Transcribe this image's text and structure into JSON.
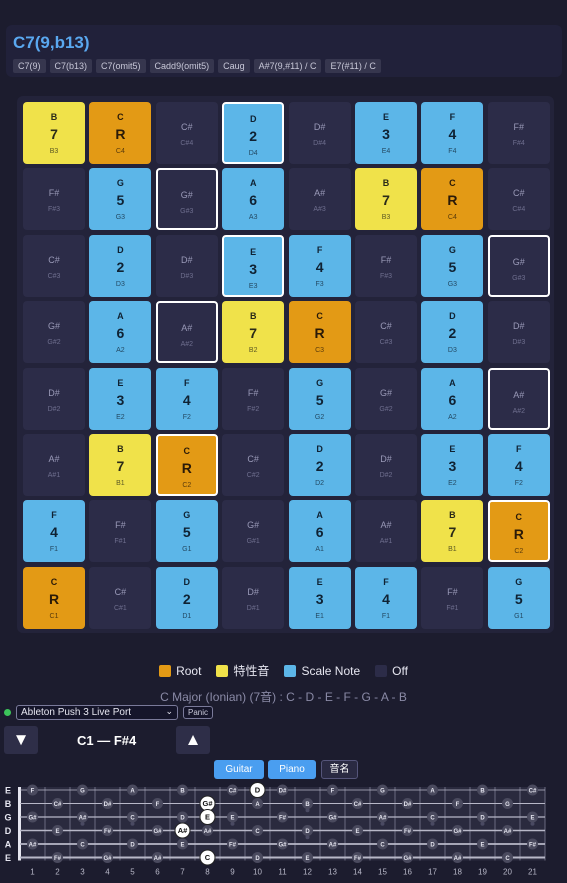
{
  "chord": {
    "title": "C7(9,b13)",
    "alternatives": [
      "C7(9)",
      "C7(b13)",
      "C7(omit5)",
      "Cadd9(omit5)",
      "Caug",
      "A#7(9,#11) / C",
      "E7(#11) / C"
    ]
  },
  "colors": {
    "root": "#e39a15",
    "characteristic": "#f0e24a",
    "scale": "#5cb6e8",
    "off": "#2c2c48"
  },
  "pads": [
    [
      {
        "n": "B",
        "d": "7",
        "s": "B3",
        "t": "char",
        "p": false
      },
      {
        "n": "C",
        "d": "R",
        "s": "C4",
        "t": "root",
        "p": false
      },
      {
        "n": "C#",
        "d": "",
        "s": "C#4",
        "t": "off",
        "p": false
      },
      {
        "n": "D",
        "d": "2",
        "s": "D4",
        "t": "scale",
        "p": true
      },
      {
        "n": "D#",
        "d": "",
        "s": "D#4",
        "t": "off",
        "p": false
      },
      {
        "n": "E",
        "d": "3",
        "s": "E4",
        "t": "scale",
        "p": false
      },
      {
        "n": "F",
        "d": "4",
        "s": "F4",
        "t": "scale",
        "p": false
      },
      {
        "n": "F#",
        "d": "",
        "s": "F#4",
        "t": "off",
        "p": false
      }
    ],
    [
      {
        "n": "F#",
        "d": "",
        "s": "F#3",
        "t": "off",
        "p": false
      },
      {
        "n": "G",
        "d": "5",
        "s": "G3",
        "t": "scale",
        "p": false
      },
      {
        "n": "G#",
        "d": "",
        "s": "G#3",
        "t": "off",
        "p": true
      },
      {
        "n": "A",
        "d": "6",
        "s": "A3",
        "t": "scale",
        "p": false
      },
      {
        "n": "A#",
        "d": "",
        "s": "A#3",
        "t": "off",
        "p": false
      },
      {
        "n": "B",
        "d": "7",
        "s": "B3",
        "t": "char",
        "p": false
      },
      {
        "n": "C",
        "d": "R",
        "s": "C4",
        "t": "root",
        "p": false
      },
      {
        "n": "C#",
        "d": "",
        "s": "C#4",
        "t": "off",
        "p": false
      }
    ],
    [
      {
        "n": "C#",
        "d": "",
        "s": "C#3",
        "t": "off",
        "p": false
      },
      {
        "n": "D",
        "d": "2",
        "s": "D3",
        "t": "scale",
        "p": false
      },
      {
        "n": "D#",
        "d": "",
        "s": "D#3",
        "t": "off",
        "p": false
      },
      {
        "n": "E",
        "d": "3",
        "s": "E3",
        "t": "scale",
        "p": true
      },
      {
        "n": "F",
        "d": "4",
        "s": "F3",
        "t": "scale",
        "p": false
      },
      {
        "n": "F#",
        "d": "",
        "s": "F#3",
        "t": "off",
        "p": false
      },
      {
        "n": "G",
        "d": "5",
        "s": "G3",
        "t": "scale",
        "p": false
      },
      {
        "n": "G#",
        "d": "",
        "s": "G#3",
        "t": "off",
        "p": true
      }
    ],
    [
      {
        "n": "G#",
        "d": "",
        "s": "G#2",
        "t": "off",
        "p": false
      },
      {
        "n": "A",
        "d": "6",
        "s": "A2",
        "t": "scale",
        "p": false
      },
      {
        "n": "A#",
        "d": "",
        "s": "A#2",
        "t": "off",
        "p": true
      },
      {
        "n": "B",
        "d": "7",
        "s": "B2",
        "t": "char",
        "p": false
      },
      {
        "n": "C",
        "d": "R",
        "s": "C3",
        "t": "root",
        "p": false
      },
      {
        "n": "C#",
        "d": "",
        "s": "C#3",
        "t": "off",
        "p": false
      },
      {
        "n": "D",
        "d": "2",
        "s": "D3",
        "t": "scale",
        "p": false
      },
      {
        "n": "D#",
        "d": "",
        "s": "D#3",
        "t": "off",
        "p": false
      }
    ],
    [
      {
        "n": "D#",
        "d": "",
        "s": "D#2",
        "t": "off",
        "p": false
      },
      {
        "n": "E",
        "d": "3",
        "s": "E2",
        "t": "scale",
        "p": false
      },
      {
        "n": "F",
        "d": "4",
        "s": "F2",
        "t": "scale",
        "p": false
      },
      {
        "n": "F#",
        "d": "",
        "s": "F#2",
        "t": "off",
        "p": false
      },
      {
        "n": "G",
        "d": "5",
        "s": "G2",
        "t": "scale",
        "p": false
      },
      {
        "n": "G#",
        "d": "",
        "s": "G#2",
        "t": "off",
        "p": false
      },
      {
        "n": "A",
        "d": "6",
        "s": "A2",
        "t": "scale",
        "p": false
      },
      {
        "n": "A#",
        "d": "",
        "s": "A#2",
        "t": "off",
        "p": true
      }
    ],
    [
      {
        "n": "A#",
        "d": "",
        "s": "A#1",
        "t": "off",
        "p": false
      },
      {
        "n": "B",
        "d": "7",
        "s": "B1",
        "t": "char",
        "p": false
      },
      {
        "n": "C",
        "d": "R",
        "s": "C2",
        "t": "root",
        "p": true
      },
      {
        "n": "C#",
        "d": "",
        "s": "C#2",
        "t": "off",
        "p": false
      },
      {
        "n": "D",
        "d": "2",
        "s": "D2",
        "t": "scale",
        "p": false
      },
      {
        "n": "D#",
        "d": "",
        "s": "D#2",
        "t": "off",
        "p": false
      },
      {
        "n": "E",
        "d": "3",
        "s": "E2",
        "t": "scale",
        "p": false
      },
      {
        "n": "F",
        "d": "4",
        "s": "F2",
        "t": "scale",
        "p": false
      }
    ],
    [
      {
        "n": "F",
        "d": "4",
        "s": "F1",
        "t": "scale",
        "p": false
      },
      {
        "n": "F#",
        "d": "",
        "s": "F#1",
        "t": "off",
        "p": false
      },
      {
        "n": "G",
        "d": "5",
        "s": "G1",
        "t": "scale",
        "p": false
      },
      {
        "n": "G#",
        "d": "",
        "s": "G#1",
        "t": "off",
        "p": false
      },
      {
        "n": "A",
        "d": "6",
        "s": "A1",
        "t": "scale",
        "p": false
      },
      {
        "n": "A#",
        "d": "",
        "s": "A#1",
        "t": "off",
        "p": false
      },
      {
        "n": "B",
        "d": "7",
        "s": "B1",
        "t": "char",
        "p": false
      },
      {
        "n": "C",
        "d": "R",
        "s": "C2",
        "t": "root",
        "p": true
      }
    ],
    [
      {
        "n": "C",
        "d": "R",
        "s": "C1",
        "t": "root",
        "p": false
      },
      {
        "n": "C#",
        "d": "",
        "s": "C#1",
        "t": "off",
        "p": false
      },
      {
        "n": "D",
        "d": "2",
        "s": "D1",
        "t": "scale",
        "p": false
      },
      {
        "n": "D#",
        "d": "",
        "s": "D#1",
        "t": "off",
        "p": false
      },
      {
        "n": "E",
        "d": "3",
        "s": "E1",
        "t": "scale",
        "p": false
      },
      {
        "n": "F",
        "d": "4",
        "s": "F1",
        "t": "scale",
        "p": false
      },
      {
        "n": "F#",
        "d": "",
        "s": "F#1",
        "t": "off",
        "p": false
      },
      {
        "n": "G",
        "d": "5",
        "s": "G1",
        "t": "scale",
        "p": false
      }
    ]
  ],
  "legend": {
    "root": "Root",
    "characteristic": "特性音",
    "scale": "Scale Note",
    "off": "Off"
  },
  "scale_info": "C Major (Ionian) (7音) : C - D - E - F - G - A - B",
  "midi": {
    "port": "Ableton Push 3 Live Port",
    "panic": "Panic"
  },
  "range": {
    "down_icon": "▼",
    "label": "C1 — F#4",
    "up_icon": "▲"
  },
  "view": {
    "guitar": "Guitar",
    "piano": "Piano",
    "names": "音名"
  },
  "fretboard": {
    "strings": [
      "E",
      "B",
      "G",
      "D",
      "A",
      "E"
    ],
    "frets": [
      "1",
      "2",
      "3",
      "4",
      "5",
      "6",
      "7",
      "8",
      "9",
      "10",
      "11",
      "12",
      "13",
      "14",
      "15",
      "16",
      "17",
      "18",
      "19",
      "20",
      "21"
    ],
    "pressed": [
      {
        "s": 0,
        "f": 10,
        "n": "D"
      },
      {
        "s": 1,
        "f": 8,
        "n": "G#"
      },
      {
        "s": 2,
        "f": 8,
        "n": "E"
      },
      {
        "s": 3,
        "f": 7,
        "n": "A#"
      },
      {
        "s": 5,
        "f": 8,
        "n": "C"
      }
    ]
  }
}
